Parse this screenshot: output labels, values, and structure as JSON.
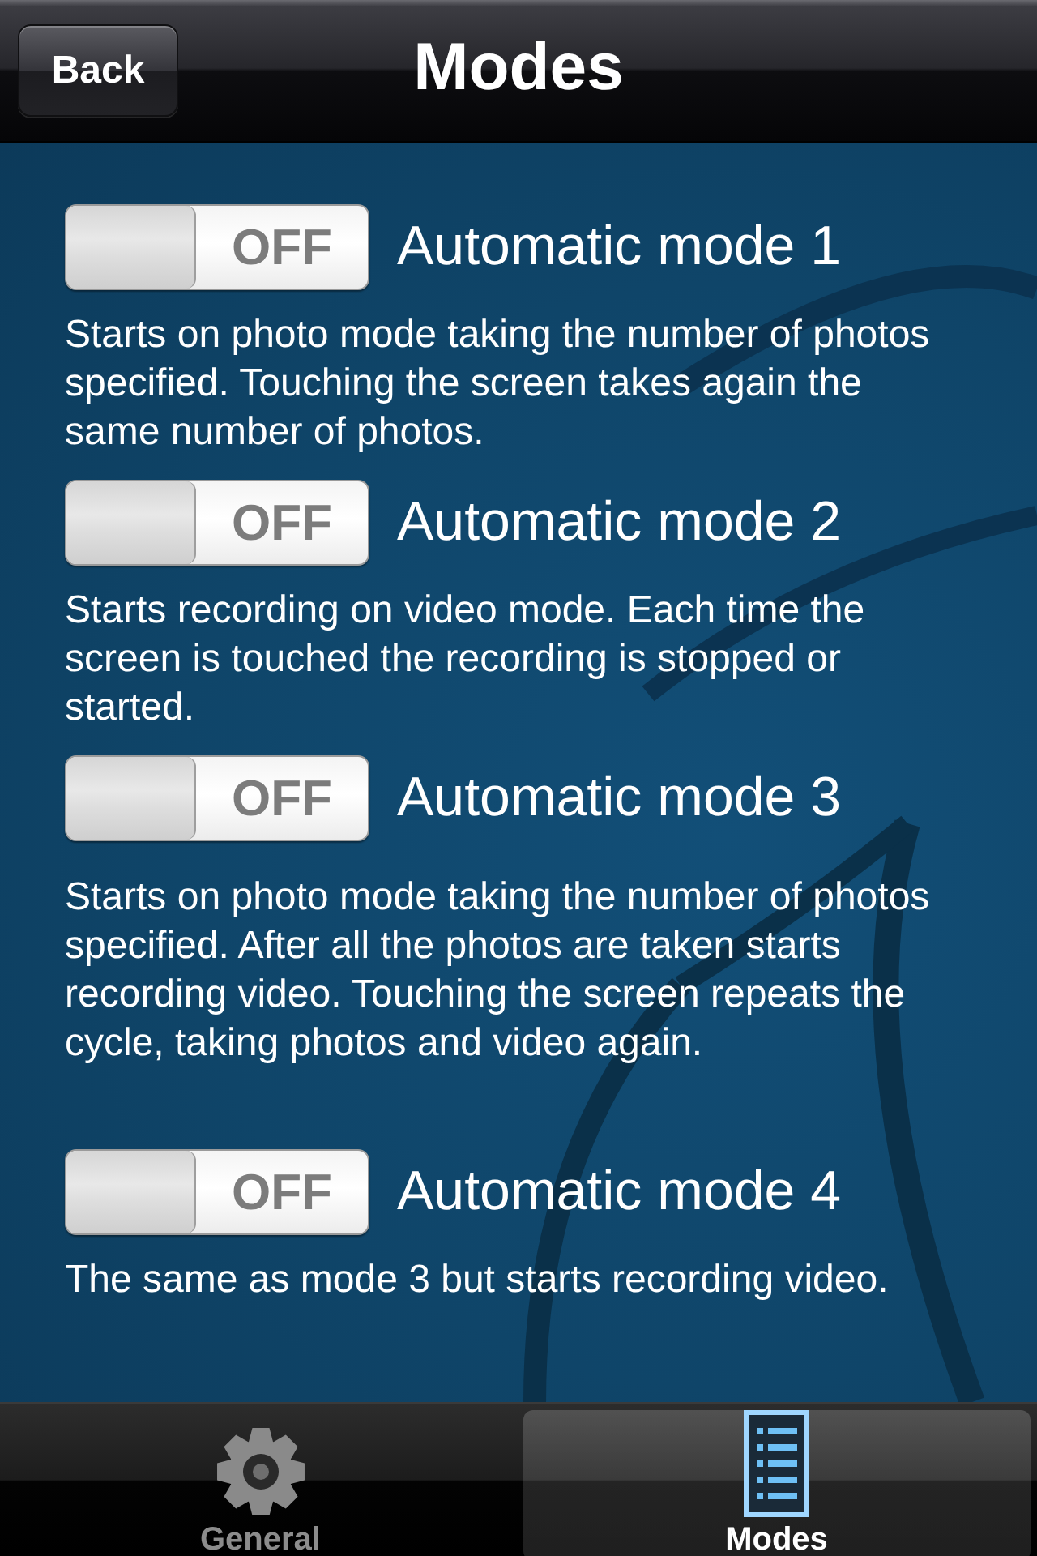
{
  "nav_bar": {
    "back_button": "Back",
    "title": "Modes"
  },
  "modes": [
    {
      "switch": {
        "label": "OFF",
        "on": false
      },
      "title": "Automatic mode 1",
      "description": "Starts on photo mode taking the number of photos specified. Touching the screen takes again the same number of photos."
    },
    {
      "switch": {
        "label": "OFF",
        "on": false
      },
      "title": "Automatic mode 2",
      "description": "Starts recording on video mode. Each time the screen is touched the recording is stopped or started."
    },
    {
      "switch": {
        "label": "OFF",
        "on": false
      },
      "title": "Automatic mode 3",
      "description": "Starts on photo mode taking the number of photos specified. After all the photos are taken starts recording video. Touching the screen repeats the cycle, taking photos and video again."
    },
    {
      "switch": {
        "label": "OFF",
        "on": false
      },
      "title": "Automatic mode 4",
      "description": "The same as mode 3 but starts recording video."
    }
  ],
  "tab_bar": {
    "tabs": [
      {
        "label": "General",
        "selected": false
      },
      {
        "label": "Modes",
        "selected": true
      }
    ]
  }
}
